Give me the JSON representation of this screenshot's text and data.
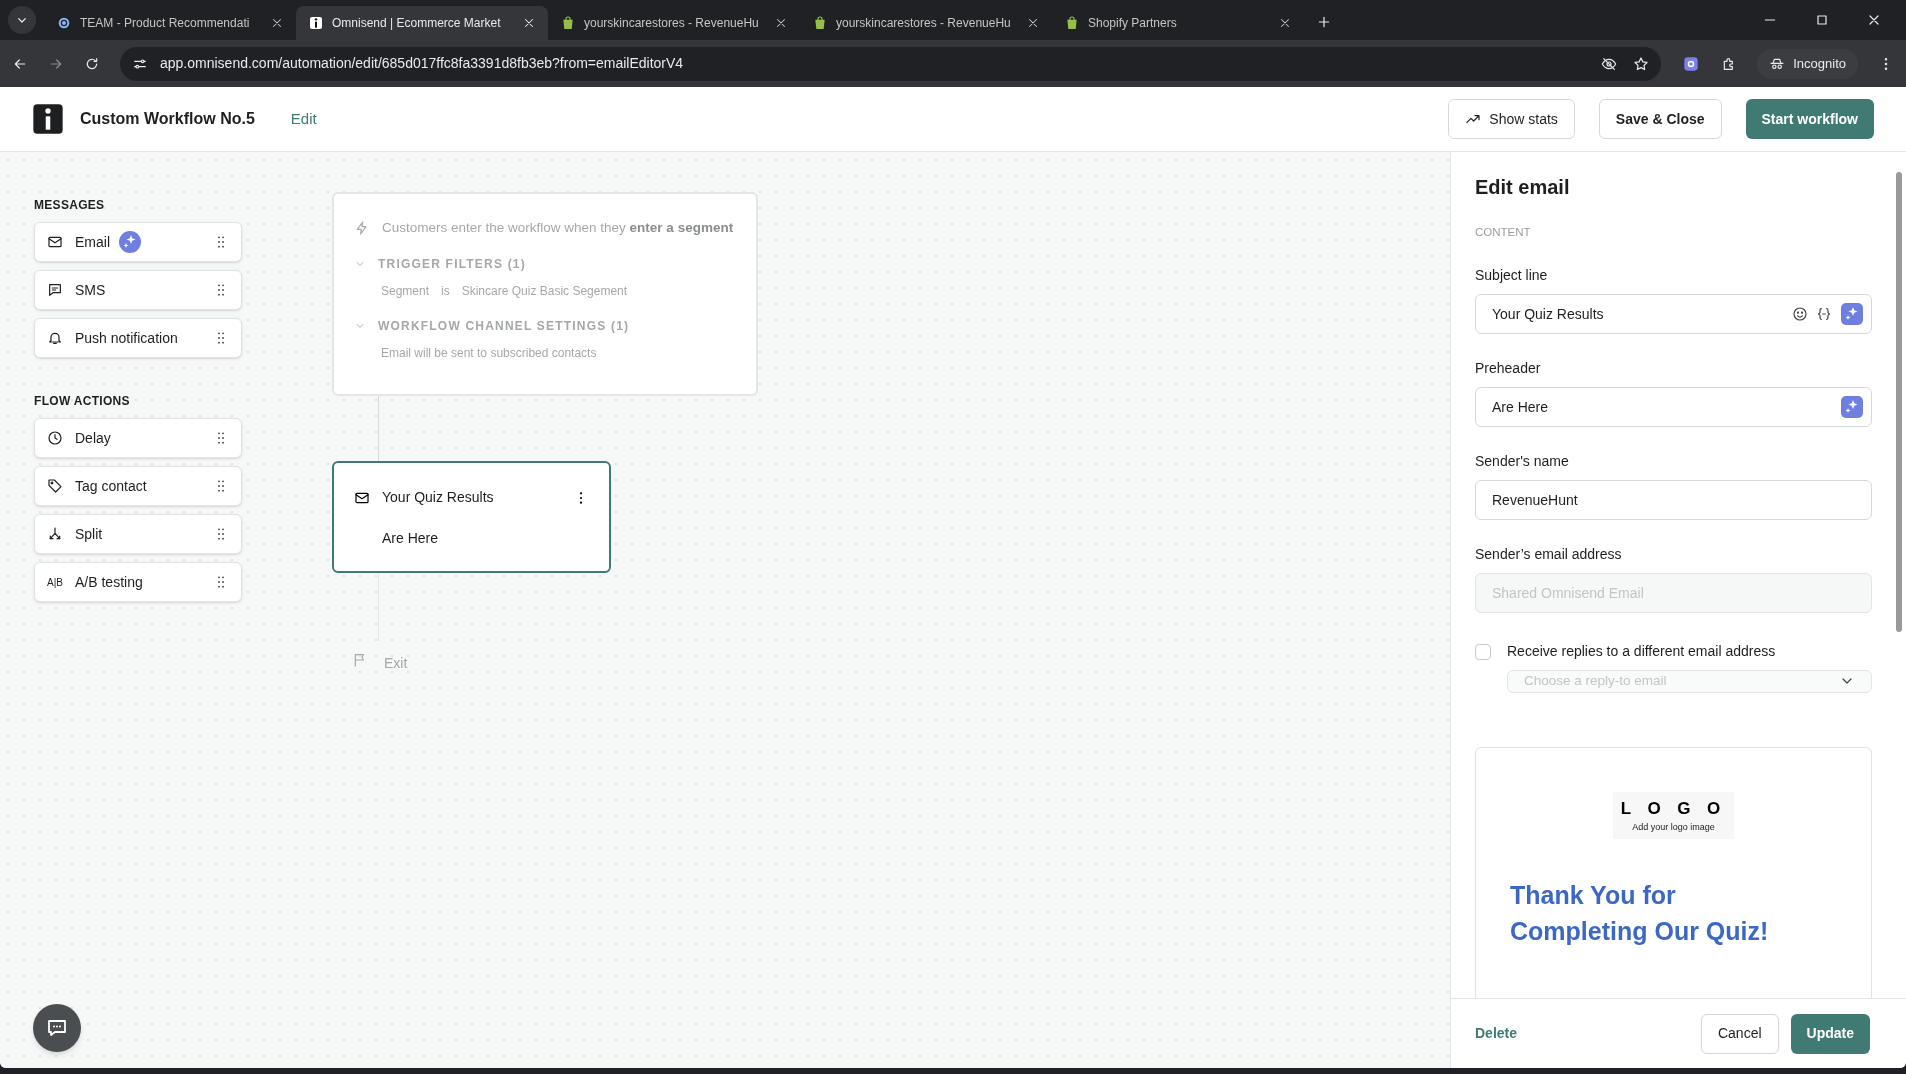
{
  "browser": {
    "tabs": [
      {
        "title": "TEAM - Product Recommendati",
        "kind": "quiz",
        "selected": false
      },
      {
        "title": "Omnisend | Ecommerce Market",
        "kind": "omnisend",
        "selected": true
      },
      {
        "title": "yourskincarestores - RevenueHu",
        "kind": "shop",
        "selected": false
      },
      {
        "title": "yourskincarestores - RevenueHu",
        "kind": "shop",
        "selected": false
      },
      {
        "title": "Shopify Partners",
        "kind": "shop",
        "selected": false
      }
    ],
    "url": "app.omnisend.com/automation/edit/685d017ffc8fa3391d8fb3eb?from=emailEditorV4",
    "profile": "Incognito"
  },
  "header": {
    "title": "Custom Workflow No.5",
    "edit_link": "Edit",
    "show_stats": "Show stats",
    "save_close": "Save & Close",
    "start": "Start workflow"
  },
  "sidebar": [
    {
      "heading": "MESSAGES",
      "items": [
        {
          "label": "Email",
          "kind": "email",
          "ai_badge": true
        },
        {
          "label": "SMS",
          "kind": "sms",
          "ai_badge": false
        },
        {
          "label": "Push notification",
          "kind": "push",
          "ai_badge": false
        }
      ]
    },
    {
      "heading": "FLOW ACTIONS",
      "items": [
        {
          "label": "Delay",
          "kind": "delay",
          "ai_badge": false
        },
        {
          "label": "Tag contact",
          "kind": "tag",
          "ai_badge": false
        },
        {
          "label": "Split",
          "kind": "split",
          "ai_badge": false
        },
        {
          "label": "A/B testing",
          "kind": "ab",
          "icon_text": "A|B",
          "ai_badge": false
        }
      ]
    }
  ],
  "canvas": {
    "trigger": {
      "text": "Customers enter the workflow when they **enter a segment**",
      "sections": [
        {
          "title": "TRIGGER FILTERS (1)",
          "detail": [
            "Segment",
            "is",
            "Skincare Quiz Basic Segement"
          ]
        },
        {
          "title": "WORKFLOW CHANNEL SETTINGS (1)",
          "detail": [
            "Email will be sent to subscribed contacts"
          ]
        }
      ]
    },
    "node": {
      "subject": "Your Quiz Results",
      "preheader": "Are Here",
      "selected": true
    },
    "exit": "Exit"
  },
  "panel": {
    "title": "Edit email",
    "section": "CONTENT",
    "fields": [
      {
        "label": "Subject line",
        "value": "Your Quiz Results",
        "emoji": true,
        "personalize": true,
        "ai": true,
        "disabled": false
      },
      {
        "label": "Preheader",
        "value": "Are Here",
        "emoji": false,
        "personalize": false,
        "ai": true,
        "disabled": false
      },
      {
        "label": "Sender's name",
        "value": "RevenueHunt",
        "emoji": false,
        "personalize": false,
        "ai": false,
        "disabled": false
      },
      {
        "label": "Sender’s email address",
        "placeholder": "Shared Omnisend Email",
        "emoji": false,
        "personalize": false,
        "ai": false,
        "disabled": true
      }
    ],
    "reply": {
      "label": "Receive replies to a different email address",
      "checked": false,
      "dropdown_placeholder": "Choose a reply-to email"
    },
    "preview": {
      "logo": "L O G O",
      "logo_hint": "Add your logo image",
      "heading": "Thank You for Completing Our Quiz!"
    },
    "delete": "Delete",
    "cancel": "Cancel",
    "update": "Update"
  }
}
